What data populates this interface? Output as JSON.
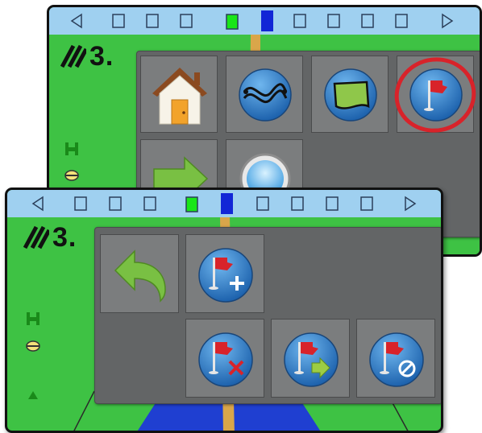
{
  "back_screen": {
    "swath_value": "3.",
    "menu_items": [
      {
        "name": "home",
        "icon": "home-icon"
      },
      {
        "name": "guidance-mode",
        "icon": "guidance-curve-icon"
      },
      {
        "name": "boundary",
        "icon": "boundary-icon"
      },
      {
        "name": "marked-points",
        "icon": "flag-icon",
        "highlighted": true
      },
      {
        "name": "next",
        "icon": "arrow-right-icon"
      },
      {
        "name": "zoom",
        "icon": "magnifier-icon"
      }
    ],
    "highlight_color": "#d8232a"
  },
  "front_screen": {
    "swath_value": "3.",
    "menu_items": [
      {
        "name": "back",
        "icon": "back-arrow-icon"
      },
      {
        "name": "add-point",
        "icon": "flag-add-icon"
      },
      {
        "name": "delete-point",
        "icon": "flag-delete-icon"
      },
      {
        "name": "navigate-to-point",
        "icon": "flag-navigate-icon"
      },
      {
        "name": "cancel-navigation",
        "icon": "flag-cancel-icon"
      }
    ]
  },
  "colors": {
    "field_green": "#3ec244",
    "sky_blue": "#9fd0f0",
    "menu_gray": "#636566",
    "tile_gray": "#7b7d7e",
    "button_blue": "#2a7cc7",
    "flag_red": "#d8232a",
    "lightbar_green": "#19e619",
    "lightbar_blue": "#1226d6"
  }
}
